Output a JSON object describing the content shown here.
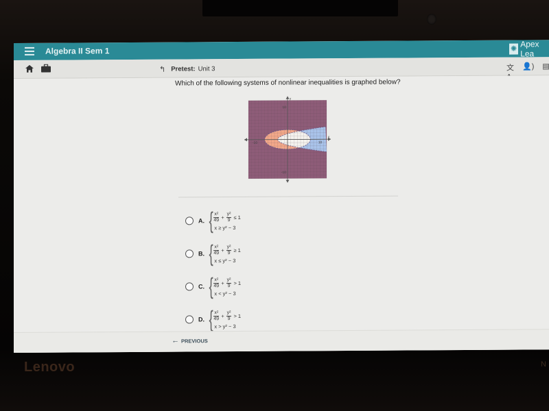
{
  "app": {
    "course_title": "Algebra II Sem 1",
    "brand": "Apex Lea",
    "colors": {
      "topbar": "#2a8a96",
      "page_bg": "#ececea"
    }
  },
  "breadcrumb": {
    "label": "Pretest:",
    "value": "Unit 3"
  },
  "nav_icons": [
    "home-icon",
    "briefcase-icon"
  ],
  "tool_icons": [
    "translate-icon",
    "text-to-speech-icon",
    "print-icon"
  ],
  "question": {
    "text": "Which of the following systems of nonlinear inequalities is graphed below?",
    "graph": {
      "x_label": "x",
      "y_label": "y",
      "tick_labels": {
        "x_neg": "-10",
        "x_pos": "10",
        "y_pos": "10",
        "y_neg": "-10"
      },
      "range": [
        -12,
        12
      ],
      "ellipse": {
        "a2": 49,
        "b2": 9,
        "boundary": "dashed",
        "shaded": "outside"
      },
      "parabola": {
        "form": "x = y^2 - 3",
        "boundary": "dashed",
        "shaded": "inside (right of vertex)"
      },
      "colors": {
        "ellipse_region": "#f2a88a",
        "parabola_region": "#a9c3ea",
        "overlap": "#8e5c78",
        "unshaded": "#f4f2ee"
      }
    }
  },
  "choices": [
    {
      "letter": "A.",
      "num1": "x²",
      "den1": "49",
      "num2": "y²",
      "den2": "9",
      "rel1": "≤ 1",
      "line2": "x ≥ y² − 3"
    },
    {
      "letter": "B.",
      "num1": "x²",
      "den1": "49",
      "num2": "y²",
      "den2": "9",
      "rel1": "≥ 1",
      "line2": "x ≤ y² − 3"
    },
    {
      "letter": "C.",
      "num1": "x²",
      "den1": "49",
      "num2": "y²",
      "den2": "9",
      "rel1": "> 1",
      "line2": "x < y² − 3"
    },
    {
      "letter": "D.",
      "num1": "x²",
      "den1": "49",
      "num2": "y²",
      "den2": "9",
      "rel1": "> 1",
      "line2": "x > y² − 3"
    }
  ],
  "footer": {
    "previous_label": "PREVIOUS"
  },
  "device": {
    "bezel_brand": "Lenovo",
    "bezel_right_text": "N"
  }
}
